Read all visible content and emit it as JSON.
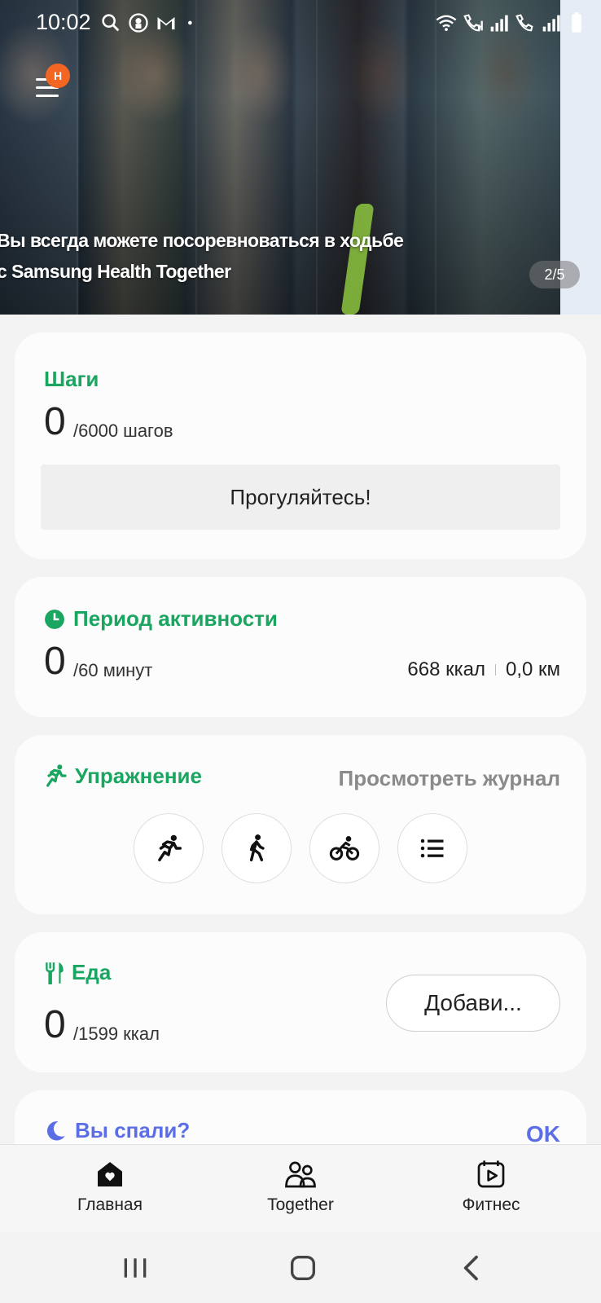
{
  "status_bar": {
    "time": "10:02"
  },
  "hero": {
    "caption_line1": "Вы всегда можете посоревноваться в ходьбе",
    "caption_line2": "с Samsung Health Together",
    "counter": "2/5",
    "menu_badge": "H"
  },
  "steps": {
    "title": "Шаги",
    "value": "0",
    "goal": "/6000 шагов",
    "button": "Прогуляйтесь!"
  },
  "activity": {
    "title": "Период активности",
    "value": "0",
    "goal": "/60 минут",
    "calories": "668 ккал",
    "distance": "0,0 км"
  },
  "exercise": {
    "title": "Упражнение",
    "log_link": "Просмотреть журнал",
    "buttons": [
      {
        "icon": "running-icon"
      },
      {
        "icon": "walking-icon"
      },
      {
        "icon": "cycling-icon"
      },
      {
        "icon": "list-icon"
      }
    ]
  },
  "food": {
    "title": "Еда",
    "value": "0",
    "goal": "/1599 ккал",
    "add_button": "Добави..."
  },
  "sleep": {
    "title": "Вы спали?",
    "ok": "OK"
  },
  "nav": {
    "items": [
      {
        "label": "Главная",
        "icon": "home-heart-icon"
      },
      {
        "label": "Together",
        "icon": "people-icon"
      },
      {
        "label": "Фитнес",
        "icon": "fitness-video-icon"
      }
    ]
  },
  "colors": {
    "accent_green": "#1aa560",
    "sleep_blue": "#5b6ee6",
    "badge_orange": "#f26522"
  }
}
